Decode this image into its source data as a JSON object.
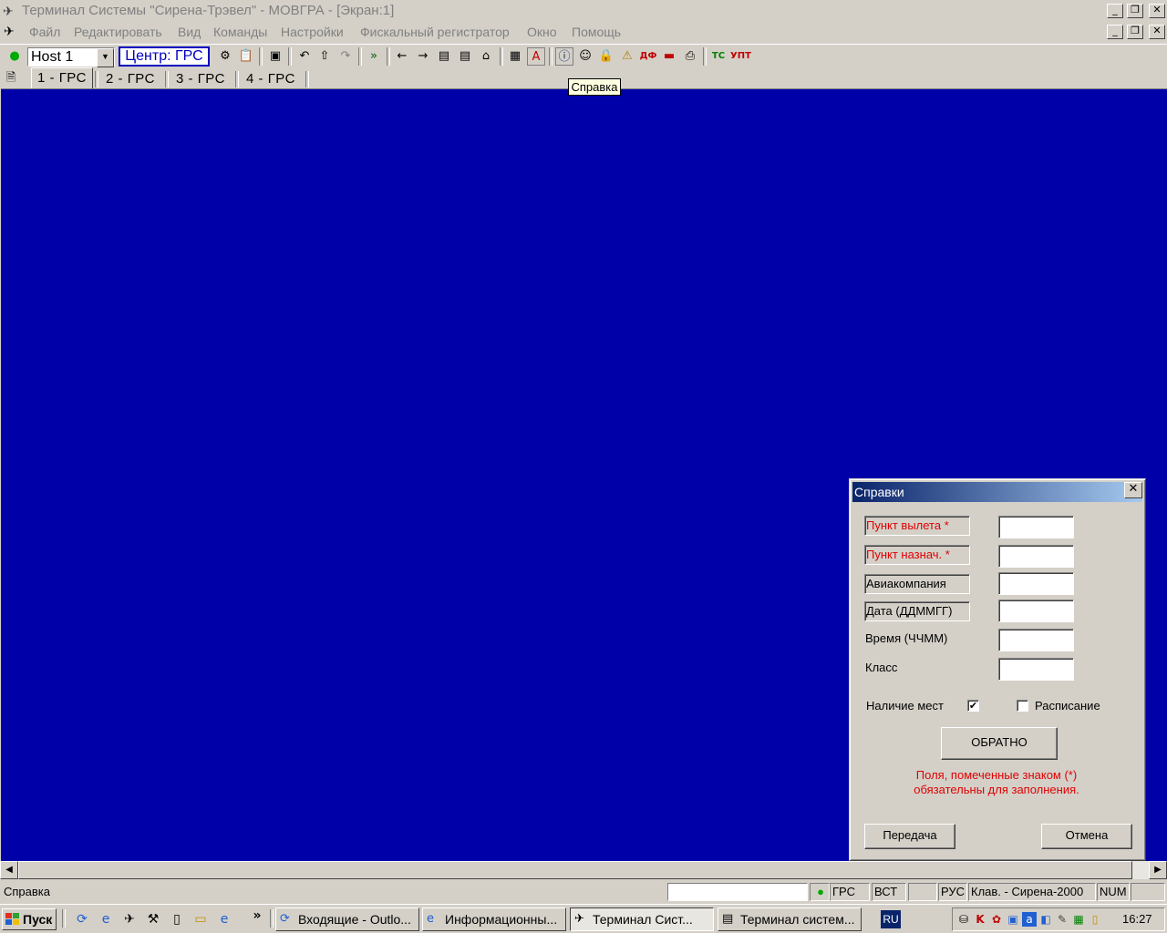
{
  "window": {
    "title": "Терминал Системы \"Сирена-Трэвел\" - МОВГРА - [Экран:1]",
    "controls": [
      "_",
      "❐",
      "✕"
    ]
  },
  "menu": {
    "items": [
      "Файл",
      "Редактировать",
      "Вид",
      "Команды",
      "Настройки",
      "Фискальный регистратор",
      "Окно",
      "Помощь"
    ]
  },
  "toolbar": {
    "host": "Host 1",
    "center": "Центр: ГРС",
    "tc_label": "ТС",
    "upt_label": "УПТ",
    "df_label": "ДФ"
  },
  "tabs": [
    "1 - ГРС",
    "2 - ГРС",
    "3 - ГРС",
    "4 - ГРС"
  ],
  "tooltip": "Справка",
  "dialog": {
    "title": "Справки",
    "fields": [
      {
        "label": "Пункт вылета *",
        "value": ""
      },
      {
        "label": "Пункт назнач. *",
        "value": ""
      },
      {
        "label": "Авиакомпания",
        "value": ""
      },
      {
        "label": "Дата (ДДММГГ)",
        "value": ""
      },
      {
        "label": "Время (ЧЧММ)",
        "value": ""
      },
      {
        "label": "Класс",
        "value": ""
      }
    ],
    "availability_label": "Наличие мест",
    "availability_checked": true,
    "schedule_label": "Расписание",
    "schedule_checked": false,
    "return_button": "ОБРАТНО",
    "note_line1": "Поля, помеченные знаком (*)",
    "note_line2": "обязательны для заполнения.",
    "send_button": "Передача",
    "cancel_button": "Отмена"
  },
  "statusbar": {
    "message": "Справка",
    "center": "ГРС",
    "insert_mode": "ВСТ",
    "language": "РУС",
    "keyboard": "Клав. - Сирена-2000",
    "num": "NUM"
  },
  "taskbar": {
    "start": "Пуск",
    "chevron": "»",
    "tasks": [
      {
        "label": "Входящие - Outlo...",
        "active": false
      },
      {
        "label": "Информационны...",
        "active": false
      },
      {
        "label": "Терминал Сист...",
        "active": true
      },
      {
        "label": "Терминал систем...",
        "active": false
      }
    ],
    "lang": "RU",
    "clock": "16:27"
  },
  "colors": {
    "terminal_bg": "#0000a8",
    "required_red": "#e00000",
    "center_blue": "#0000c0",
    "caption_start": "#0a246a",
    "caption_end": "#a6caf0"
  }
}
